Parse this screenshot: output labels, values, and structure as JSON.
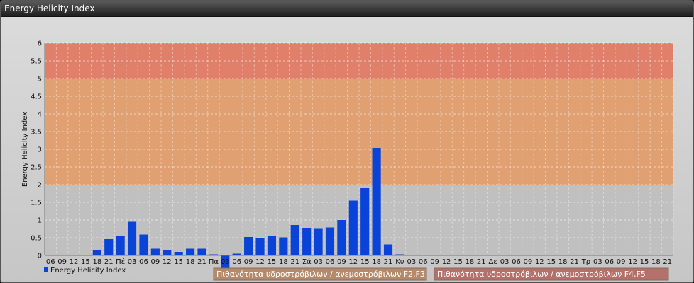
{
  "window": {
    "title": "Energy Helicity Index"
  },
  "chart_data": {
    "type": "bar",
    "ylabel": "Energy Helicity Index",
    "ylim": [
      0,
      6
    ],
    "y_ticks": [
      "0",
      "0.5",
      "1",
      "1.5",
      "2",
      "2.5",
      "3",
      "3.5",
      "4",
      "4.5",
      "5",
      "5.5",
      "6"
    ],
    "grid": true,
    "categories": [
      "06",
      "09",
      "12",
      "15",
      "18",
      "21",
      "Πέ",
      "03",
      "06",
      "09",
      "12",
      "15",
      "18",
      "21",
      "Πα",
      "03",
      "06",
      "09",
      "12",
      "15",
      "18",
      "21",
      "Σά",
      "03",
      "06",
      "09",
      "12",
      "15",
      "18",
      "21",
      "Κυ",
      "03",
      "06",
      "09",
      "12",
      "15",
      "18",
      "21",
      "Δε",
      "03",
      "06",
      "09",
      "12",
      "15",
      "18",
      "21",
      "Τρ",
      "03",
      "06",
      "09",
      "12",
      "15",
      "18",
      "21"
    ],
    "series": [
      {
        "name": "Energy Helicity Index",
        "color": "#0a43d8",
        "values": [
          0.01,
          0.01,
          0.01,
          0.01,
          0.16,
          0.46,
          0.56,
          0.95,
          0.59,
          0.19,
          0.14,
          0.1,
          0.19,
          0.19,
          0.03,
          -0.35,
          0.05,
          0.52,
          0.49,
          0.54,
          0.51,
          0.86,
          0.78,
          0.77,
          0.79,
          1.0,
          1.55,
          1.9,
          3.04,
          0.31,
          0.03,
          0.01,
          0.01,
          0.01,
          0.01,
          0.01,
          0.01,
          0.01,
          0.01,
          0.01,
          0.01,
          0.01,
          0.01,
          0.01,
          0.01,
          0.01,
          0.01,
          0.01,
          0.01,
          0.01,
          0.01,
          0.01,
          0.01,
          0.01
        ]
      }
    ],
    "bands": [
      {
        "from": 5,
        "to": 6,
        "color": "#e0806a"
      },
      {
        "from": 2,
        "to": 5,
        "color": "#e0a072"
      },
      {
        "from": 0,
        "to": 2,
        "color": "#c0c0c0"
      }
    ],
    "legend": {
      "label": "Energy Helicity Index",
      "color": "#0a43d8",
      "position": "bottom-left"
    },
    "band_labels": [
      {
        "label": "Πιθανότητα υδροστρόβιλων / ανεμοστρόβιλων F2,F3",
        "color": "#b58a6a"
      },
      {
        "label": "Πιθανότητα υδροστρόβιλων / ανεμοστρόβιλων F4,F5",
        "color": "#b4706a"
      }
    ]
  }
}
